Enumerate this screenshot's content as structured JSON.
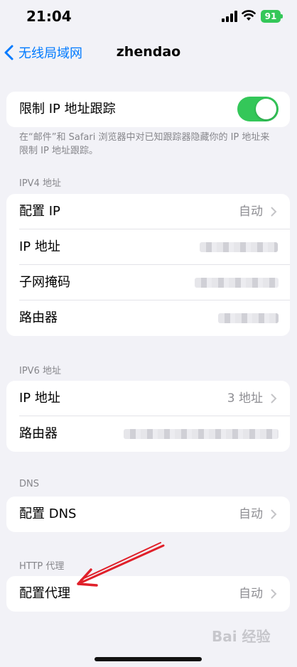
{
  "status_bar": {
    "time": "21:04",
    "battery": "91"
  },
  "nav": {
    "back_label": "无线局域网",
    "title": "zhendao"
  },
  "privacy": {
    "limit_tracking_label": "限制 IP 地址跟踪",
    "limit_tracking_on": true,
    "footer": "在“邮件”和 Safari 浏览器中对已知跟踪器隐藏你的 IP 地址来限制 IP 地址跟踪。"
  },
  "ipv4": {
    "header": "IPV4 地址",
    "rows": [
      {
        "label": "配置 IP",
        "value": "自动"
      },
      {
        "label": "IP 地址"
      },
      {
        "label": "子网掩码"
      },
      {
        "label": "路由器"
      }
    ]
  },
  "ipv6": {
    "header": "IPV6 地址",
    "rows": [
      {
        "label": "IP 地址",
        "value": "3 地址"
      },
      {
        "label": "路由器"
      }
    ]
  },
  "dns": {
    "header": "DNS",
    "label": "配置 DNS",
    "value": "自动"
  },
  "http_proxy": {
    "header": "HTTP 代理",
    "label": "配置代理",
    "value": "自动"
  },
  "colors": {
    "accent": "#007aff",
    "toggle_on": "#34c759",
    "background": "#f2f2f7",
    "annotation_arrow": "#e0202a"
  },
  "watermark": "Bai 经验"
}
